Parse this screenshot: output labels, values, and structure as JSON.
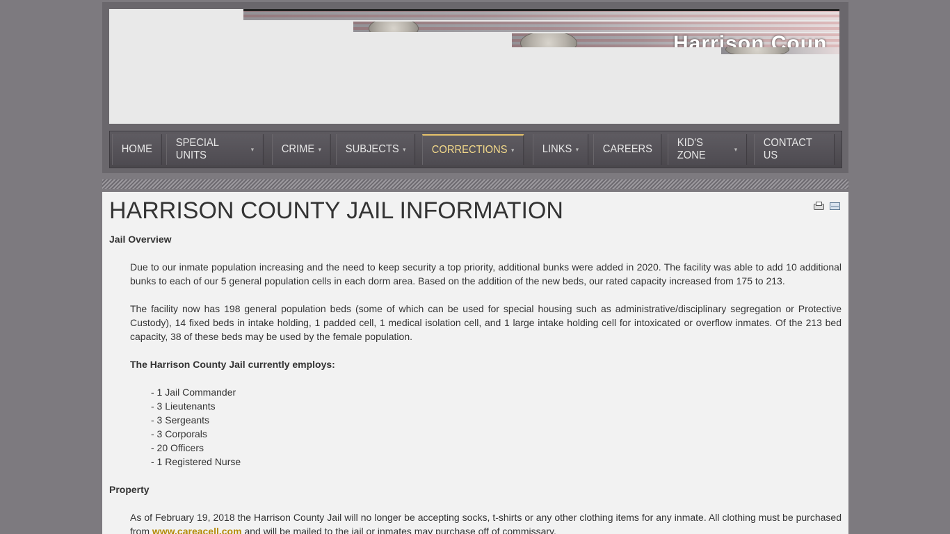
{
  "banner": {
    "title": "Harrison Coun"
  },
  "nav": {
    "items": [
      {
        "label": "HOME",
        "has_submenu": false
      },
      {
        "label": "SPECIAL UNITS",
        "has_submenu": true
      },
      {
        "label": "CRIME",
        "has_submenu": true
      },
      {
        "label": "SUBJECTS",
        "has_submenu": true
      },
      {
        "label": "CORRECTIONS",
        "has_submenu": true,
        "active": true
      },
      {
        "label": "LINKS",
        "has_submenu": true
      },
      {
        "label": "CAREERS",
        "has_submenu": false
      },
      {
        "label": "KID'S ZONE",
        "has_submenu": true
      },
      {
        "label": "CONTACT US",
        "has_submenu": false
      }
    ],
    "caret": "▾"
  },
  "colors": {
    "background": "#7d7a7f",
    "nav_active": "#f2d88a",
    "link": "#b68a0a"
  },
  "article": {
    "title": "HARRISON COUNTY JAIL INFORMATION",
    "icons": [
      "print-icon",
      "email-icon"
    ],
    "overview_heading": "Jail Overview",
    "para1": "Due to our inmate population increasing and the need to keep security a top priority, additional bunks were added in 2020. The facility was able to add 10 additional bunks to each of our 5 general population cells in each dorm area. Based on the addition of the new beds, our rated capacity increased from 175 to 213.",
    "para2": "The facility now has 198 general population beds (some of which can be used for special housing such as administrative/disciplinary segregation or Protective Custody), 14 fixed beds in intake holding, 1 padded cell, 1 medical isolation cell, and 1 large intake holding cell for intoxicated or overflow inmates.  Of the 213 bed capacity, 38 of these beds may be used by the female population.",
    "employs_heading": "The Harrison County Jail currently employs:",
    "staff": [
      "- 1 Jail Commander",
      "- 3 Lieutenants",
      "- 3 Sergeants",
      "- 3 Corporals",
      "- 20 Officers",
      "- 1 Registered Nurse"
    ],
    "property_heading": "Property",
    "property_text_before": "As of February 19, 2018 the Harrison County Jail will no longer be accepting socks, t-shirts or any other clothing items for any inmate. All clothing must be purchased from ",
    "property_link": "www.careacell.com",
    "property_text_after": " and will be mailed to the jail or inmates may purchase off of commissary."
  }
}
